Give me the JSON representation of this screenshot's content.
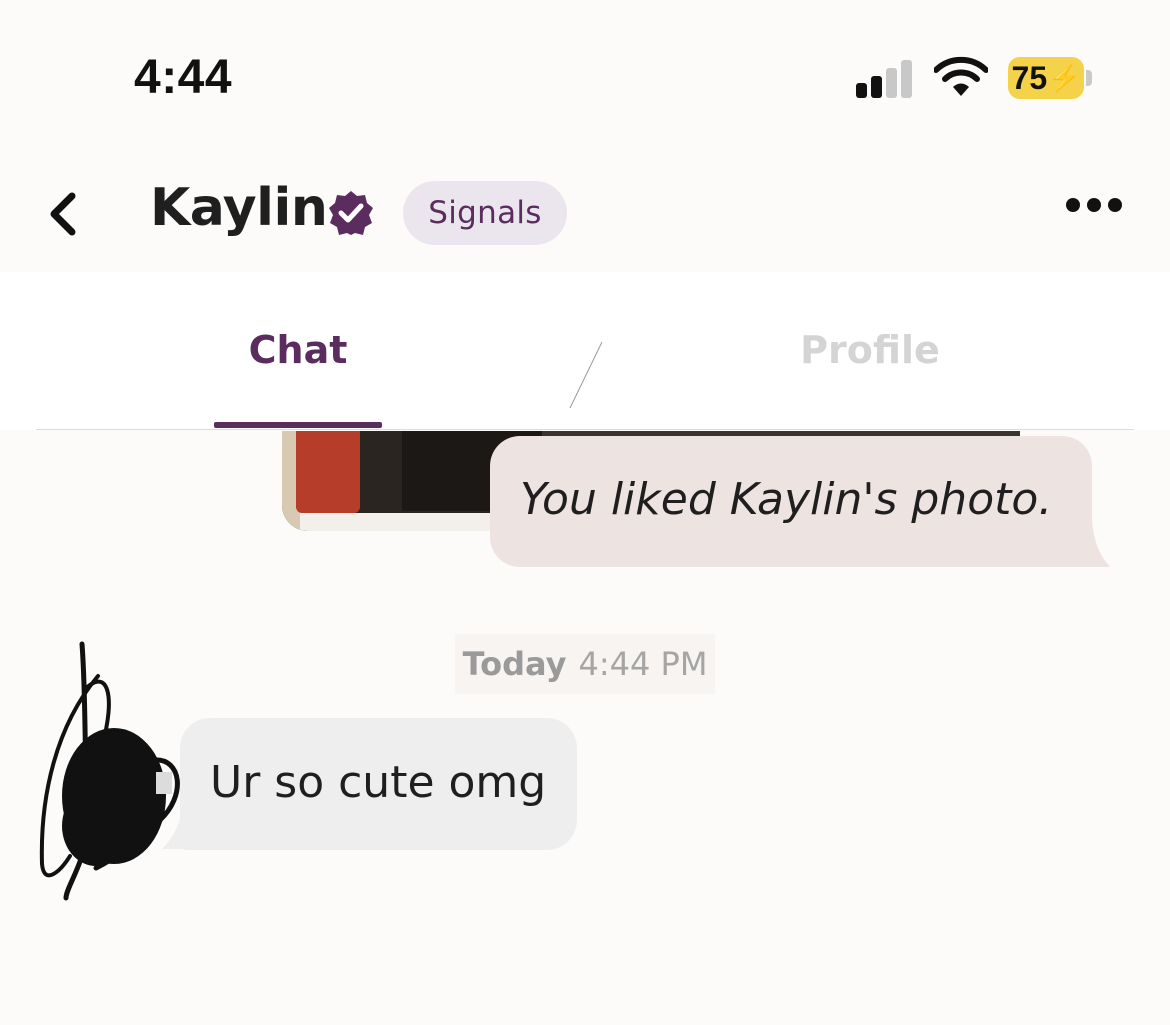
{
  "status_bar": {
    "time": "4:44",
    "battery_percent": "75",
    "signal_icon": "cellular-signal-icon",
    "wifi_icon": "wifi-icon",
    "charging_icon": "charging-bolt-icon",
    "signal_bars_active": 2,
    "signal_bars_total": 4,
    "battery_color": "#f4d24a"
  },
  "header": {
    "back_icon": "chevron-left-icon",
    "contact_name": "Kaylin",
    "verified_icon": "verified-badge-icon",
    "signals_label": "Signals",
    "more_icon": "more-dots-icon",
    "accent_color": "#5a2d5e"
  },
  "tabs": [
    {
      "label": "Chat",
      "active": true
    },
    {
      "label": "Profile",
      "active": false
    }
  ],
  "conversation": {
    "liked_photo_message": "You liked Kaylin's photo.",
    "timestamp_day": "Today",
    "timestamp_time": "4:44 PM",
    "received_message": "Ur so cute omg"
  }
}
